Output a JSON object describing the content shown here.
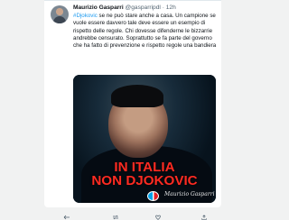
{
  "tweet": {
    "author_name": "Maurizio Gasparri",
    "author_handle": "@gasparripdl",
    "separator": "·",
    "time": "12h",
    "hashtag": "#Djokovic",
    "text_part_1": " se ne può stare anche a casa. Un campione se vuole essere davvero tale deve essere un esempio di rispetto delle regole. Chi dovesse difenderne le bizzarrie andrebbe censurato. Soprattutto se fa parte del governo che ha fatto di prevenzione e rispetto regole una bandiera"
  },
  "media": {
    "headline_line_1": "IN ITALIA",
    "headline_line_2": "NON DJOKOVIC",
    "signature": "Maurizio Gasparri",
    "headline_color": "#ff2b22"
  },
  "actions": {
    "reply_icon": "reply-icon",
    "retweet_icon": "retweet-icon",
    "like_icon": "heart-icon",
    "share_icon": "share-icon"
  }
}
